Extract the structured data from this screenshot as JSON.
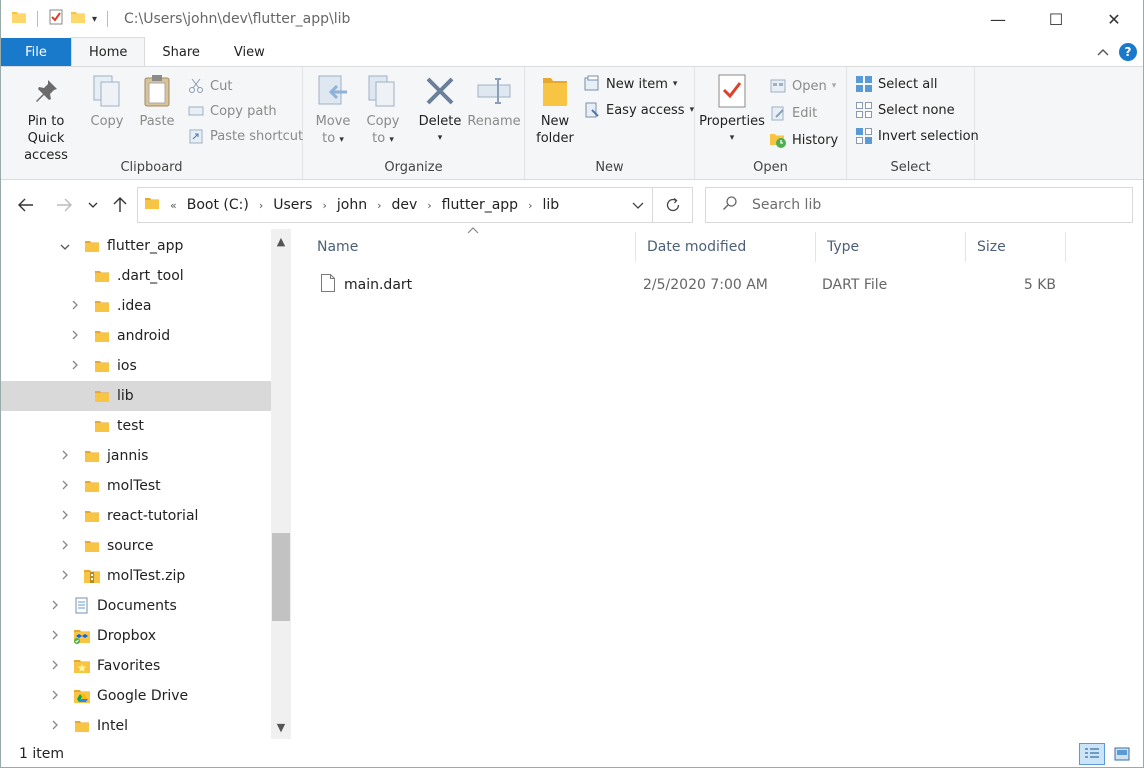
{
  "window": {
    "title_path": "C:\\Users\\john\\dev\\flutter_app\\lib",
    "controls": {
      "minimize": "—",
      "maximize": "☐",
      "close": "✕"
    }
  },
  "tabs": [
    {
      "label": "File"
    },
    {
      "label": "Home"
    },
    {
      "label": "Share"
    },
    {
      "label": "View"
    }
  ],
  "ribbon": {
    "clipboard": {
      "name": "Clipboard",
      "pin_label_1": "Pin to Quick",
      "pin_label_2": "access",
      "copy": "Copy",
      "paste": "Paste",
      "cut": "Cut",
      "copy_path": "Copy path",
      "paste_shortcut": "Paste shortcut"
    },
    "organize": {
      "name": "Organize",
      "move_to_1": "Move",
      "move_to_2": "to",
      "copy_to_1": "Copy",
      "copy_to_2": "to",
      "delete": "Delete",
      "rename": "Rename"
    },
    "new": {
      "name": "New",
      "new_folder_1": "New",
      "new_folder_2": "folder",
      "new_item": "New item",
      "easy_access": "Easy access"
    },
    "open": {
      "name": "Open",
      "properties": "Properties",
      "open": "Open",
      "edit": "Edit",
      "history": "History"
    },
    "select": {
      "name": "Select",
      "select_all": "Select all",
      "select_none": "Select none",
      "invert_selection": "Invert selection"
    }
  },
  "address": {
    "overflow": "«",
    "crumbs": [
      "Boot (C:)",
      "Users",
      "john",
      "dev",
      "flutter_app",
      "lib"
    ],
    "search_placeholder": "Search lib"
  },
  "nav_tree": [
    {
      "label": "flutter_app",
      "level": 1,
      "expander": "open",
      "icon": "folder-icon"
    },
    {
      "label": ".dart_tool",
      "level": 2,
      "expander": "none",
      "icon": "folder-icon"
    },
    {
      "label": ".idea",
      "level": 2,
      "expander": "closed",
      "icon": "folder-icon"
    },
    {
      "label": "android",
      "level": 2,
      "expander": "closed",
      "icon": "folder-icon"
    },
    {
      "label": "ios",
      "level": 2,
      "expander": "closed",
      "icon": "folder-icon"
    },
    {
      "label": "lib",
      "level": 2,
      "expander": "none",
      "icon": "folder-icon",
      "selected": true
    },
    {
      "label": "test",
      "level": 2,
      "expander": "none",
      "icon": "folder-icon"
    },
    {
      "label": "jannis",
      "level": 1,
      "expander": "closed",
      "icon": "folder-icon"
    },
    {
      "label": "molTest",
      "level": 1,
      "expander": "closed",
      "icon": "folder-icon"
    },
    {
      "label": "react-tutorial",
      "level": 1,
      "expander": "closed",
      "icon": "folder-icon"
    },
    {
      "label": "source",
      "level": 1,
      "expander": "closed",
      "icon": "folder-icon"
    },
    {
      "label": "molTest.zip",
      "level": 1,
      "expander": "closed",
      "icon": "zip-folder-icon"
    },
    {
      "label": "Documents",
      "level": 0,
      "expander": "closed",
      "icon": "documents-icon"
    },
    {
      "label": "Dropbox",
      "level": 0,
      "expander": "closed",
      "icon": "dropbox-icon"
    },
    {
      "label": "Favorites",
      "level": 0,
      "expander": "closed",
      "icon": "favorites-icon"
    },
    {
      "label": "Google Drive",
      "level": 0,
      "expander": "closed",
      "icon": "google-drive-icon"
    },
    {
      "label": "Intel",
      "level": 0,
      "expander": "closed",
      "icon": "folder-icon"
    }
  ],
  "file_list": {
    "columns": [
      "Name",
      "Date modified",
      "Type",
      "Size"
    ],
    "rows": [
      {
        "name": "main.dart",
        "date": "2/5/2020 7:00 AM",
        "type": "DART File",
        "size": "5 KB"
      }
    ]
  },
  "status": {
    "item_count": "1 item"
  },
  "colors": {
    "accent": "#1979ca",
    "folder": "#f8c443",
    "selection": "#d9d9d9"
  }
}
